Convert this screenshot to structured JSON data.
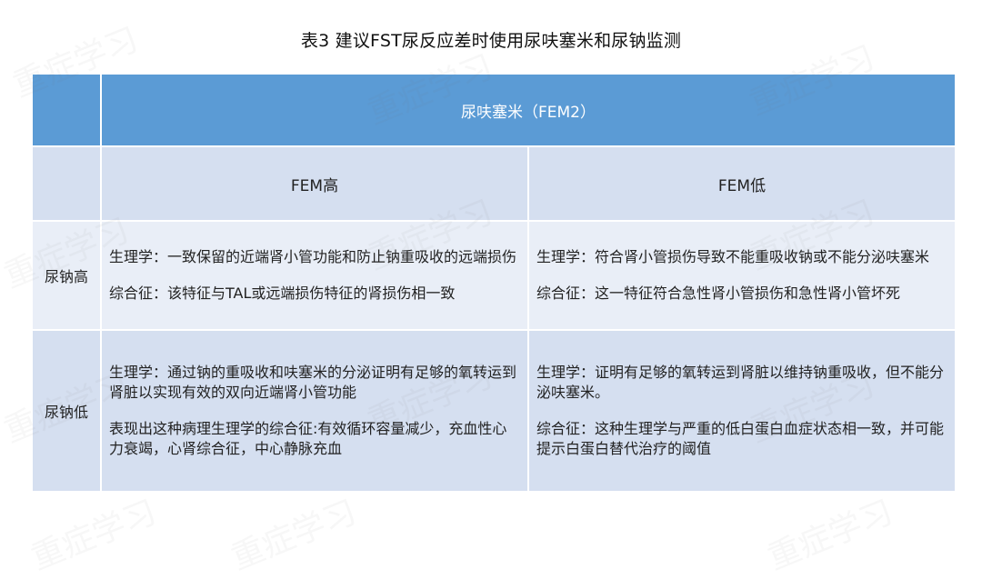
{
  "title": "表3 建议FST尿反应差时使用尿呋塞米和尿钠监测",
  "table": {
    "header": "尿呋塞米（FEM2）",
    "subheaders": [
      "FEM高",
      "FEM低"
    ],
    "rows": [
      {
        "label": "尿钠高",
        "cells": [
          {
            "physiology": "生理学：一致保留的近端肾小管功能和防止钠重吸收的远端损伤",
            "syndrome": "综合征：该特征与TAL或远端损伤特征的肾损伤相一致"
          },
          {
            "physiology": "生理学：符合肾小管损伤导致不能重吸收钠或不能分泌呋塞米",
            "syndrome": "综合征：这一特征符合急性肾小管损伤和急性肾小管坏死"
          }
        ]
      },
      {
        "label": "尿钠低",
        "cells": [
          {
            "physiology": "生理学：通过钠的重吸收和呋塞米的分泌证明有足够的氧转运到肾脏以实现有效的双向近端肾小管功能",
            "syndrome": "表现出这种病理生理学的综合征:有效循环容量减少，充血性心力衰竭，心肾综合征，中心静脉充血"
          },
          {
            "physiology": "生理学：证明有足够的氧转运到肾脏以维持钠重吸收，但不能分泌呋塞米。",
            "syndrome": "综合征：这种生理学与严重的低白蛋白血症状态相一致，并可能提示白蛋白替代治疗的阈值"
          }
        ]
      }
    ]
  },
  "watermark": "重症学习",
  "colors": {
    "header_bg": "#5b9bd5",
    "subheader_bg": "#d5dff0",
    "row_light": "#e9eef7",
    "row_dark": "#d5dff0"
  }
}
